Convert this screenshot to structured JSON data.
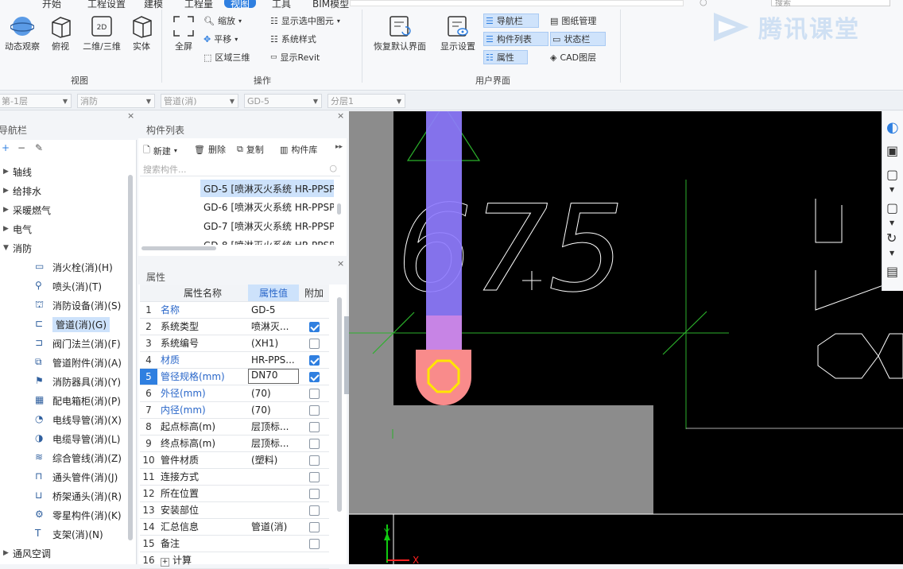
{
  "menu_tabs": [
    "开始",
    "工程设置",
    "建模",
    "工程量",
    "视图",
    "工具",
    "BIM模型"
  ],
  "search_placeholder": "搜索",
  "watermark": "腾讯课堂",
  "ribbon": {
    "view_group": {
      "label": "视图",
      "buttons": [
        "动态观察",
        "俯视",
        "二维/三维",
        "实体"
      ],
      "icon_2d_text": "2D"
    },
    "operate_group": {
      "label": "操作",
      "fullscreen": "全屏",
      "zoom": "缩放",
      "pan": "平移",
      "region3d": "区域三维",
      "show_selected": "显示选中图元",
      "system_style": "系统样式",
      "show_revit": "显示Revit"
    },
    "ui_group": {
      "label": "用户界面",
      "restore": "恢复默认界面",
      "display_settings": "显示设置",
      "navbar": "导航栏",
      "component_list": "构件列表",
      "properties": "属性",
      "drawing_mgmt": "图纸管理",
      "status_bar": "状态栏",
      "cad_layer": "CAD图层"
    }
  },
  "dropdowns": [
    "第-1层",
    "消防",
    "管道(消)",
    "GD-5",
    "分层1"
  ],
  "nav_panel": {
    "title": "导航栏",
    "categories": [
      "轴线",
      "给排水",
      "采暖燃气",
      "电气",
      "消防"
    ],
    "subitems": [
      "消火栓(消)(H)",
      "喷头(消)(T)",
      "消防设备(消)(S)",
      "管道(消)(G)",
      "阀门法兰(消)(F)",
      "管道附件(消)(A)",
      "消防器具(消)(Y)",
      "配电箱柜(消)(P)",
      "电线导管(消)(X)",
      "电缆导管(消)(L)",
      "综合管线(消)(Z)",
      "通头管件(消)(J)",
      "桥架通头(消)(R)",
      "零星构件(消)(K)",
      "支架(消)(N)"
    ],
    "last_category": "通风空调"
  },
  "component_panel": {
    "title": "构件列表",
    "new": "新建",
    "delete": "删除",
    "copy": "复制",
    "library": "构件库",
    "search_placeholder": "搜索构件...",
    "items": [
      "GD-5 [喷淋灭火系统 HR-PPSP",
      "GD-6 [喷淋灭火系统 HR-PPSP",
      "GD-7 [喷淋灭火系统 HR-PPSP",
      "GD-8 [喷淋灭火系统 HR-PPSP"
    ]
  },
  "props_panel": {
    "title": "属性",
    "headers": [
      "属性名称",
      "属性值",
      "附加"
    ],
    "rows": [
      {
        "no": "1",
        "name": "名称",
        "value": "GD-5",
        "check": null,
        "blue": true
      },
      {
        "no": "2",
        "name": "系统类型",
        "value": "喷淋灭...",
        "check": true,
        "blue": false
      },
      {
        "no": "3",
        "name": "系统编号",
        "value": "(XH1)",
        "check": false,
        "blue": false
      },
      {
        "no": "4",
        "name": "材质",
        "value": "HR-PPS...",
        "check": true,
        "blue": true
      },
      {
        "no": "5",
        "name": "管径规格(mm)",
        "value": "DN70",
        "check": true,
        "blue": true
      },
      {
        "no": "6",
        "name": "外径(mm)",
        "value": "(70)",
        "check": false,
        "blue": true
      },
      {
        "no": "7",
        "name": "内径(mm)",
        "value": "(70)",
        "check": false,
        "blue": true
      },
      {
        "no": "8",
        "name": "起点标高(m)",
        "value": "层顶标...",
        "check": false,
        "blue": false
      },
      {
        "no": "9",
        "name": "终点标高(m)",
        "value": "层顶标...",
        "check": false,
        "blue": false
      },
      {
        "no": "10",
        "name": "管件材质",
        "value": "(塑料)",
        "check": false,
        "blue": false
      },
      {
        "no": "11",
        "name": "连接方式",
        "value": "",
        "check": false,
        "blue": false
      },
      {
        "no": "12",
        "name": "所在位置",
        "value": "",
        "check": false,
        "blue": false
      },
      {
        "no": "13",
        "name": "安装部位",
        "value": "",
        "check": false,
        "blue": false
      },
      {
        "no": "14",
        "name": "汇总信息",
        "value": "管道(消)",
        "check": false,
        "blue": false
      },
      {
        "no": "15",
        "name": "备注",
        "value": "",
        "check": false,
        "blue": false
      },
      {
        "no": "16",
        "name": "计算",
        "value": "",
        "check": null,
        "blue": false
      }
    ],
    "expand_symbol": "+"
  },
  "canvas": {
    "dim_text_1": "675",
    "axis_y": "Y",
    "axis_x": "X"
  },
  "colors": {
    "accent": "#2f7fe0",
    "canvas_bg": "#000000",
    "pipe": "#8f7cff",
    "pipe_end": "#f98b8b",
    "wall": "#8c8c8c"
  }
}
